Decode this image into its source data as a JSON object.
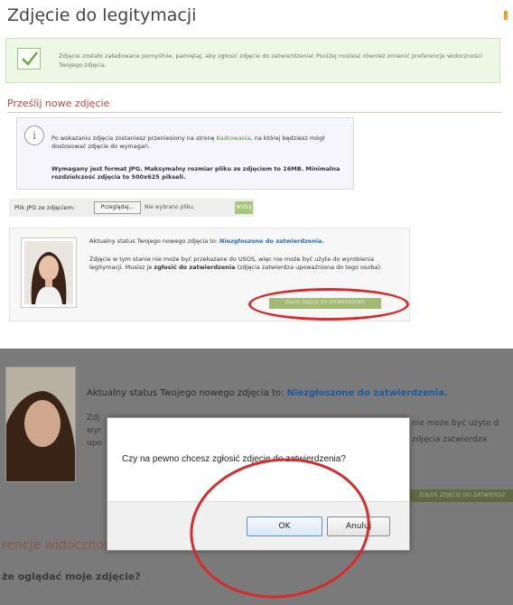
{
  "top": {
    "title": "Zdjęcie do legitymacji",
    "success_message": "Zdjęcie zostało załadowane pomyślnie, pamiętaj, aby zgłosić zdjęcie do zatwierdzenia! Poniżej możesz również zmienić preferencje widoczności Twojego zdjęcia.",
    "section_title": "Prześlij nowe zdjęcie",
    "info": {
      "p1_before": "Po wskazaniu zdjęcia zostaniesz przeniesiony na stronę ",
      "p1_link": "Kadrowania",
      "p1_after": ", na której będziesz mógł dostosować zdjęcie do wymagań.",
      "p2_before": "Wymagany jest format ",
      "p2_format": "JPG",
      "p2_mid": ". Maksymalny rozmiar pliku ze zdjęciem to ",
      "p2_size": "16MB",
      "p2_mid2": ". Minimalna rozdzielczość zdjęcia to ",
      "p2_res": "500x625",
      "p2_after": " pikseli."
    },
    "file_row": {
      "label": "Plik JPG ze zdjęciem:",
      "browse": "Przeglądaj...",
      "no_file": "Nie wybrano pliku.",
      "send": "WYŚLIJ"
    },
    "status": {
      "line_prefix": "Aktualny status Twojego nowego zdjęcia to: ",
      "line_status": "Niezgłoszone do zatwierdzenia.",
      "p_before": "Zdjęcie w tym stanie nie może być przekazane do USOS, więc nie może być użyte do wyrobienia legitymacji. Musisz je ",
      "p_bold": "zgłosić do zatwierdzenia",
      "p_after": " (zdjęcia zatwierdza upoważniona do tego osoba).",
      "submit": "ZGŁOŚ ZDJĘCIE DO ZATWIERDZENIA"
    }
  },
  "bottom": {
    "bg_line_prefix": "Aktualny status Twojego nowego zdjęcia to: ",
    "bg_line_status": "Niezgłoszone do zatwierdzenia.",
    "bg_left": [
      "Zdj",
      "wyr",
      "upo"
    ],
    "bg_right": [
      "nie może być użyte d",
      "zdjęcia zatwierdza"
    ],
    "bg_submit": "ZGŁOŚ ZDJĘCIE DO ZATWIERDZ",
    "bg_heading": "rencje widoczności",
    "bg_sub": "że oglądać moje zdjęcie?",
    "dialog": {
      "message": "Czy na pewno chcesz zgłosić zdjęcie do zatwierdzenia?",
      "ok": "OK",
      "cancel": "Anuluj"
    }
  },
  "colors": {
    "annotation_red": "#d42d2d",
    "success_green": "#eef6e6",
    "status_blue": "#2a6eb5",
    "section_red": "#b94a3c",
    "button_green": "#a3b976"
  }
}
